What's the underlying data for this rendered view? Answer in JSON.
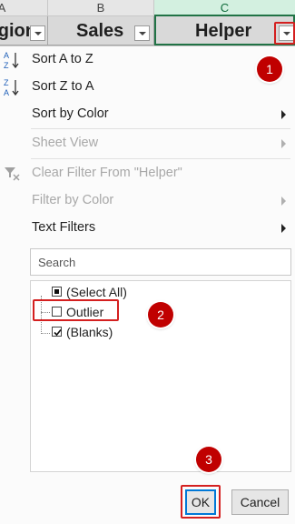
{
  "columns": {
    "a": "A",
    "b": "B",
    "c": "C"
  },
  "header_cells": {
    "region_partial": "gion",
    "sales": "Sales",
    "helper": "Helper"
  },
  "menu": {
    "sort_az": {
      "label": "Sort A to Z",
      "enabled": true
    },
    "sort_za": {
      "label": "Sort Z to A",
      "enabled": true
    },
    "sort_by_color": {
      "label": "Sort by Color",
      "enabled": true,
      "submenu": true
    },
    "sheet_view": {
      "label": "Sheet View",
      "enabled": false,
      "submenu": true
    },
    "clear_filter": {
      "label": "Clear Filter From \"Helper\"",
      "enabled": false
    },
    "filter_by_color": {
      "label": "Filter by Color",
      "enabled": false,
      "submenu": true
    },
    "text_filters": {
      "label": "Text Filters",
      "enabled": true,
      "submenu": true
    }
  },
  "search": {
    "placeholder": "Search"
  },
  "values": [
    {
      "label": "(Select All)",
      "state": "indeterminate"
    },
    {
      "label": "Outlier",
      "state": "unchecked"
    },
    {
      "label": "(Blanks)",
      "state": "checked"
    }
  ],
  "buttons": {
    "ok": "OK",
    "cancel": "Cancel"
  },
  "annotations": {
    "step1": "1",
    "step2": "2",
    "step3": "3",
    "color": "#c00000"
  },
  "colors": {
    "selected_column": "#217346",
    "highlight": "#d42020"
  }
}
